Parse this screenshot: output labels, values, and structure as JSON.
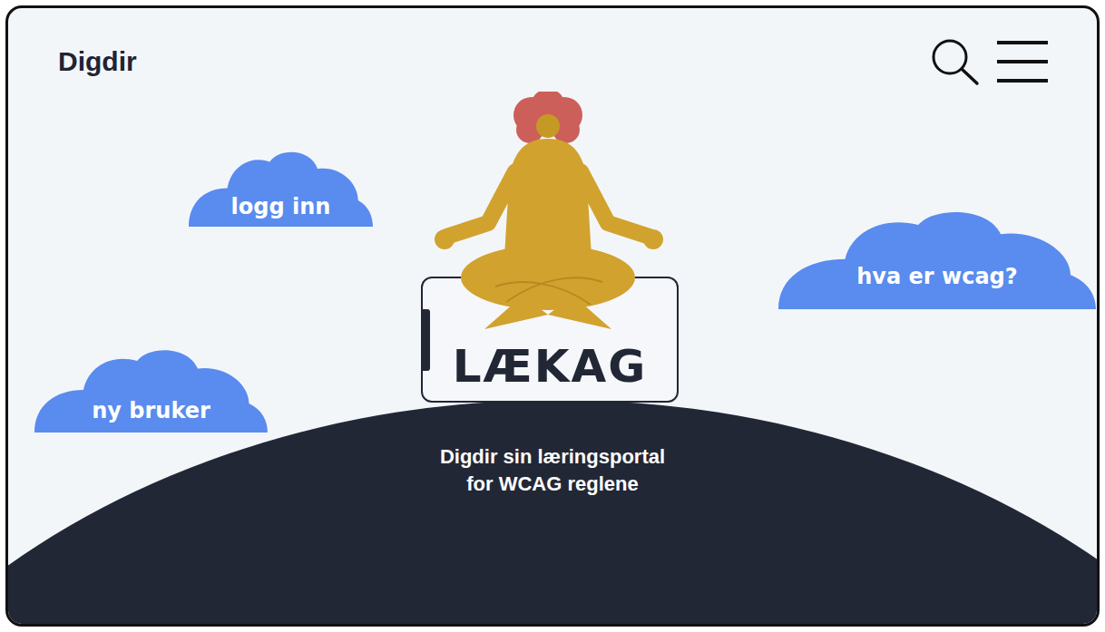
{
  "header": {
    "brand": "Digdir"
  },
  "clouds": [
    {
      "label": "logg inn"
    },
    {
      "label": "ny bruker"
    },
    {
      "label": "hva er wcag?"
    }
  ],
  "logo": {
    "text": "LÆKAG"
  },
  "tagline": [
    "Digdir sin læringsportal",
    "for WCAG reglene"
  ]
}
